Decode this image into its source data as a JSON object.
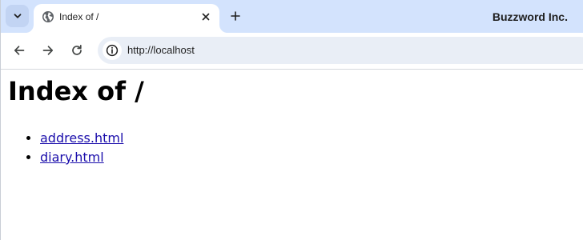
{
  "browser": {
    "colors": {
      "tabstrip": "#d3e3fd",
      "omnibox": "#e9eef6",
      "link": "#1a0dab"
    },
    "tab": {
      "title": "Index of /",
      "favicon": "globe-icon"
    },
    "profile_label": "Buzzword Inc.",
    "toolbar": {
      "back_icon": "arrow-left-icon",
      "forward_icon": "arrow-right-icon",
      "reload_icon": "reload-icon"
    },
    "address_bar": {
      "url": "http://localhost",
      "site_info_icon": "info-icon"
    }
  },
  "page": {
    "heading": "Index of /",
    "files": [
      {
        "name": "address.html"
      },
      {
        "name": "diary.html"
      }
    ]
  }
}
